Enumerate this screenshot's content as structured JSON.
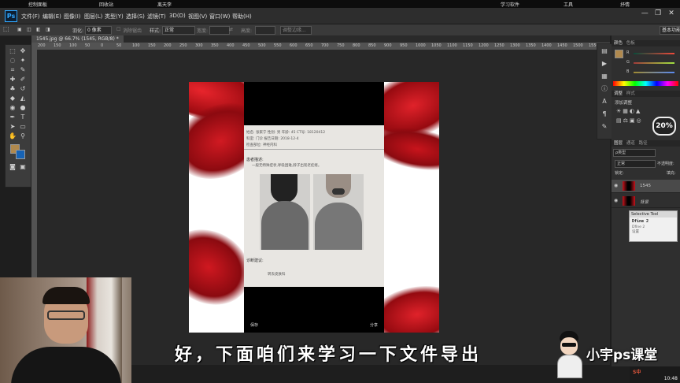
{
  "taskbar_top": {
    "items": [
      "控制面板",
      "回收站",
      "离天李",
      "学习软件",
      "工具",
      "抒情"
    ]
  },
  "menu": {
    "app_logo": "Ps",
    "items": [
      "文件(F)",
      "编辑(E)",
      "图像(I)",
      "图层(L)",
      "类型(Y)",
      "选择(S)",
      "滤镜(T)",
      "3D(D)",
      "视图(V)",
      "窗口(W)",
      "帮助(H)"
    ],
    "window_controls": [
      "—",
      "❐",
      "✕"
    ]
  },
  "options": {
    "feather_label": "羽化:",
    "feather_value": "0 像素",
    "antialias_label": "消除锯齿",
    "style_label": "样式:",
    "style_value": "正常",
    "width_label": "宽度:",
    "height_label": "高度:",
    "refine_edge_label": "调整边缘...",
    "workspace_label": "基本功能"
  },
  "document": {
    "tab_title": "1545.jpg @ 66.7% (1545, RGB/8) *",
    "ruler_ticks": [
      "200",
      "150",
      "100",
      "50",
      "0",
      "50",
      "100",
      "150",
      "200",
      "250",
      "300",
      "350",
      "400",
      "450",
      "500",
      "550",
      "600",
      "650",
      "700",
      "750",
      "800",
      "850",
      "900",
      "950",
      "1000",
      "1050",
      "1100",
      "1150",
      "1200",
      "1250",
      "1300",
      "1350",
      "1400",
      "1450",
      "1500",
      "1550",
      "1600"
    ]
  },
  "paper": {
    "row1": "姓名: 张家宁        性别: 男        年龄: 45        CT号: 18120412",
    "row2": "科室: 门诊          报告日期: 2018-12-4",
    "row3": "检查部位: 神经内科",
    "desc_title": "患者描述:",
    "desc_text": "一般无特殊症状,呼吸困难,脖子出现老疙瘩。",
    "diag_title": "诊断建议:",
    "diag_text": "转去皮肤科",
    "save_label": "保存",
    "share_label": "分享"
  },
  "panels": {
    "color_tab": "颜色",
    "swatches_tab": "色板",
    "channels": [
      "R",
      "G",
      "B"
    ],
    "adjust_tab": "调整",
    "styles_tab": "样式",
    "add_adjust_label": "添加调整",
    "layers_tab": "图层",
    "channels_tab": "通道",
    "paths_tab": "路径",
    "kind_label": "ρ类型",
    "blend_mode": "正常",
    "opacity_label": "不透明度:",
    "lock_label": "锁定:",
    "fill_label": "填充:",
    "layers": [
      "1545",
      "背景"
    ],
    "zoom_badge": "20%"
  },
  "selective_tool": {
    "title": "Selective Tool",
    "value1": "Dfine 2",
    "value2": "Dfine 2",
    "value3": "设置"
  },
  "video": {
    "subtitle": "好，下面咱们来学习一下文件导出",
    "brand": "小宇ps课堂"
  },
  "system": {
    "clock": "10:48",
    "ime": "S中"
  },
  "colors": {
    "ps_accent": "#31a8ff",
    "silk_red": "#c8101a",
    "panel_bg": "#2f2f2f",
    "canvas_bg": "#282828"
  }
}
